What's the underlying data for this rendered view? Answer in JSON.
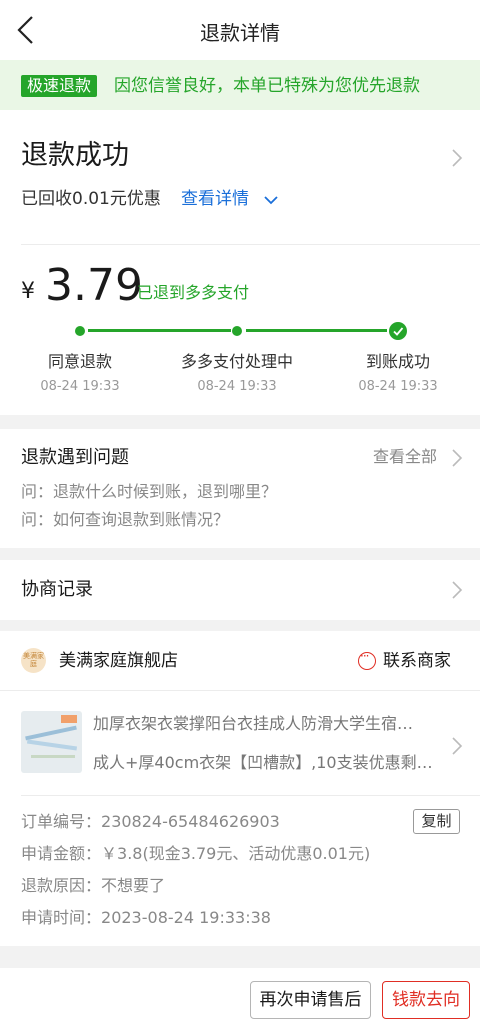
{
  "header": {
    "title": "退款详情"
  },
  "banner": {
    "tag": "极速退款",
    "message": "因您信誉良好，本单已特殊为您优先退款"
  },
  "refund": {
    "status": "退款成功",
    "recovered": "已回收0.01元优惠",
    "details_link": "查看详情",
    "currency": "¥",
    "amount": "3.79",
    "destination": "已退到多多支付",
    "steps": [
      {
        "label": "同意退款",
        "time": "08-24 19:33"
      },
      {
        "label": "多多支付处理中",
        "time": "08-24 19:33"
      },
      {
        "label": "到账成功",
        "time": "08-24 19:33"
      }
    ],
    "completed_steps": 3
  },
  "problems": {
    "title": "退款遇到问题",
    "see_all": "查看全部",
    "questions": [
      "问：退款什么时候到账，退到哪里？",
      "问：如何查询退款到账情况？"
    ]
  },
  "negotiation": {
    "title": "协商记录"
  },
  "order": {
    "shop_logo_text": "美满家庭",
    "shop_name": "美满家庭旗舰店",
    "contact_label": "联系商家",
    "product_title": "加厚衣架衣裳撑阳台衣挂成人防滑大学生宿…",
    "product_spec": "成人+厚40cm衣架【凹槽款】,10支装优惠剩…",
    "rows": [
      {
        "key": "订单编号：",
        "value": "230824-65484626903"
      },
      {
        "key": "申请金额：",
        "value": "￥3.8(现金3.79元、活动优惠0.01元)"
      },
      {
        "key": "退款原因：",
        "value": "不想要了"
      },
      {
        "key": "申请时间：",
        "value": "2023-08-24 19:33:38"
      }
    ],
    "copy_label": "复制"
  },
  "footer": {
    "apply_again": "再次申请售后",
    "money_where": "钱款去向"
  },
  "colors": {
    "accent_green": "#25a52a",
    "link_blue": "#1a6fd9",
    "brand_red": "#e02e24"
  }
}
